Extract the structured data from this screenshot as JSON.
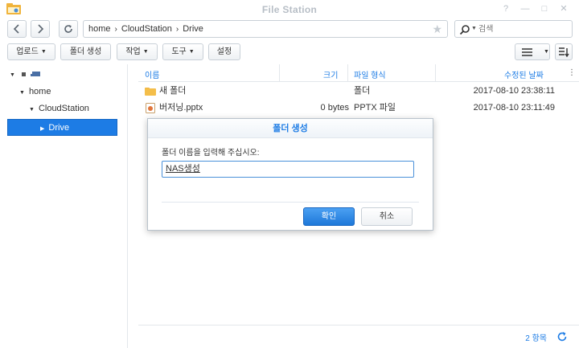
{
  "window": {
    "title": "File Station"
  },
  "path": {
    "crumbs": [
      "home",
      "CloudStation",
      "Drive"
    ]
  },
  "search": {
    "placeholder": "검색"
  },
  "toolbar": {
    "upload": "업로드",
    "create_folder": "폴더 생성",
    "action": "작업",
    "tools": "도구",
    "settings": "설정"
  },
  "tree": {
    "home": "home",
    "cloudstation": "CloudStation",
    "drive": "Drive"
  },
  "columns": {
    "name": "이름",
    "size": "크기",
    "type": "파일 형식",
    "modified": "수정된 날짜"
  },
  "files": [
    {
      "name": "새 폴더",
      "size": "",
      "type": "폴더",
      "modified": "2017-08-10 23:38:11",
      "icon": "folder-icon"
    },
    {
      "name": "버저닝.pptx",
      "size": "0 bytes",
      "type": "PPTX 파일",
      "modified": "2017-08-10 23:11:49",
      "icon": "pptx-file-icon"
    }
  ],
  "status": {
    "count": "2 항목"
  },
  "dialog": {
    "title": "폴더 생성",
    "prompt": "폴더 이름을 입력해 주십시오:",
    "value": "NAS생성",
    "ok": "확인",
    "cancel": "취소"
  },
  "colors": {
    "accent": "#1d7ce5",
    "selection": "#1d7ce5"
  }
}
